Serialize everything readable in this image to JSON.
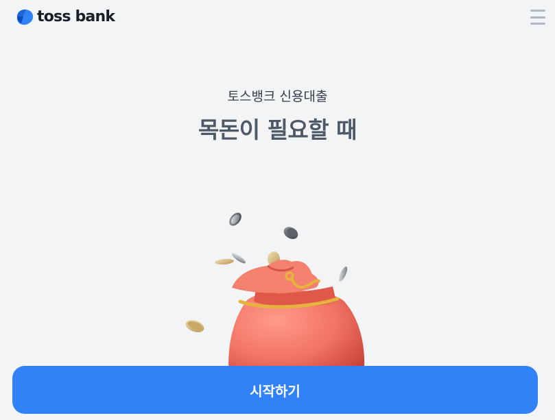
{
  "header": {
    "logo_text": "toss bank",
    "logo_icon": "toss-logo-icon",
    "menu_icon": "hamburger-menu-icon"
  },
  "hero": {
    "subtitle": "토스뱅크 신용대출",
    "title": "목돈이 필요할 때"
  },
  "illustration": {
    "icon": "money-bag-with-coins"
  },
  "cta": {
    "label": "시작하기"
  },
  "colors": {
    "background": "#f2f4f6",
    "accent": "#3182f6",
    "title_text": "#4e5968",
    "bag": "#f07060"
  }
}
